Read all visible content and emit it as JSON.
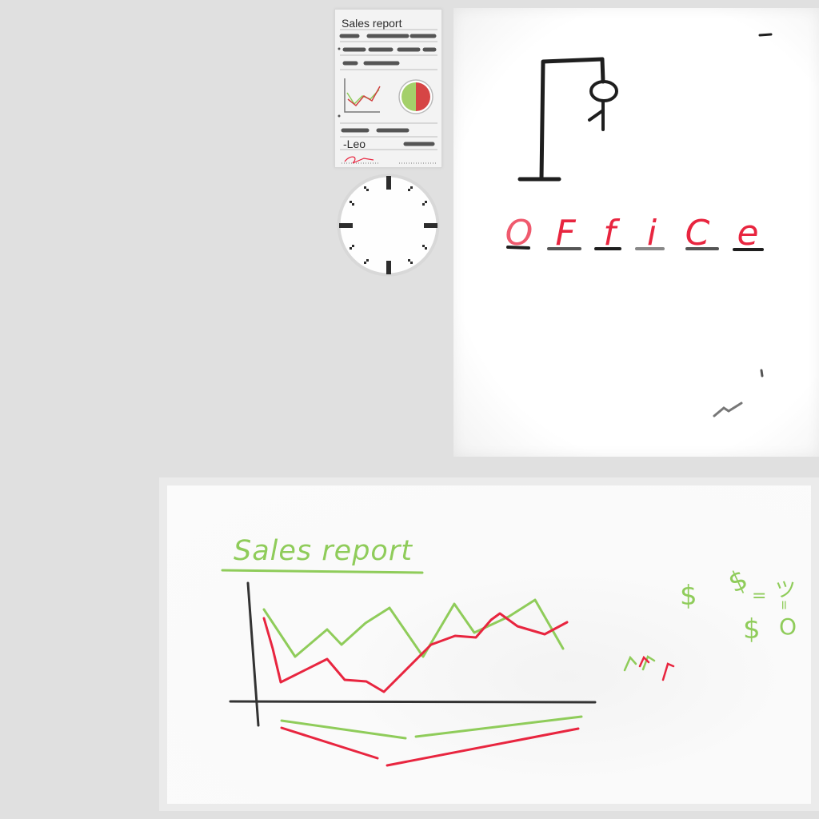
{
  "thumbnail": {
    "title": "Sales report",
    "signature": "-Leo"
  },
  "hangman": {
    "letters": [
      "O",
      "F",
      "f",
      "i",
      "C",
      "e"
    ],
    "letter_color": "#e8253f"
  },
  "sales_board": {
    "title": "Sales report",
    "symbols": {
      "dollar_a": "$",
      "dollar_b": "$",
      "dollar_c": "$",
      "equals": "=",
      "happy_face": "ツ",
      "equals_b": "=",
      "shock_face": "O"
    },
    "colors": {
      "green": "#8fcc5a",
      "red": "#e8253f",
      "axis": "#333333"
    }
  },
  "colors": {
    "background": "#e0e0e0",
    "board": "#ffffff"
  }
}
